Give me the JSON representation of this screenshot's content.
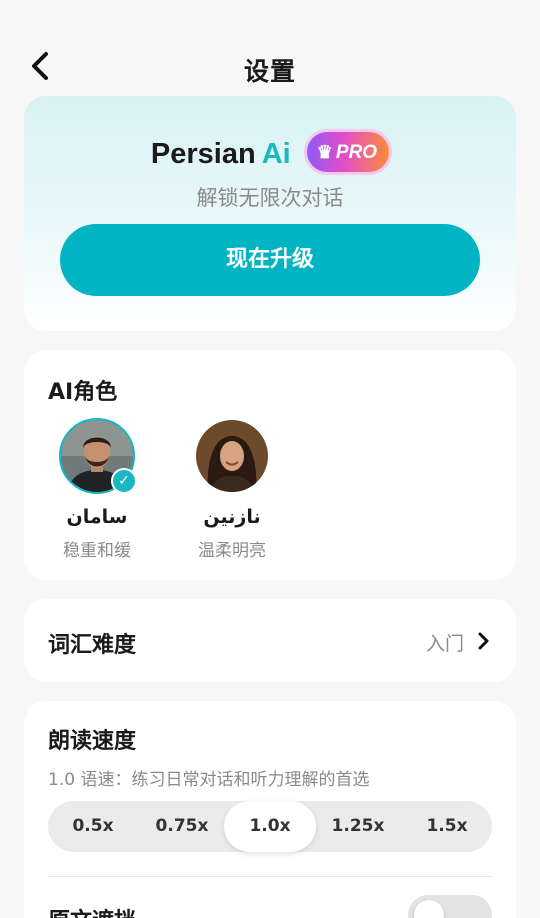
{
  "header": {
    "title": "设置",
    "back_icon": "chevron-left-icon"
  },
  "promo": {
    "brand": "Persian",
    "brand_ai": "Ai",
    "badge": "PRO",
    "badge_icon": "crown-icon",
    "subtitle": "解锁无限次对话",
    "upgrade_label": "现在升级",
    "accent_color": "#00b4c4"
  },
  "roles": {
    "title": "AI角色",
    "items": [
      {
        "name": "سامان",
        "desc": "稳重和缓",
        "selected": true
      },
      {
        "name": "نازنین",
        "desc": "温柔明亮",
        "selected": false
      }
    ]
  },
  "vocab": {
    "label": "词汇难度",
    "value": "入门",
    "chevron_icon": "chevron-right-icon"
  },
  "speed": {
    "title": "朗读速度",
    "description": "1.0 语速：练习日常对话和听力理解的首选",
    "options": [
      "0.5x",
      "0.75x",
      "1.0x",
      "1.25x",
      "1.5x"
    ],
    "selected": "1.0x"
  },
  "original_text": {
    "label": "原文遮挡",
    "enabled": false
  }
}
